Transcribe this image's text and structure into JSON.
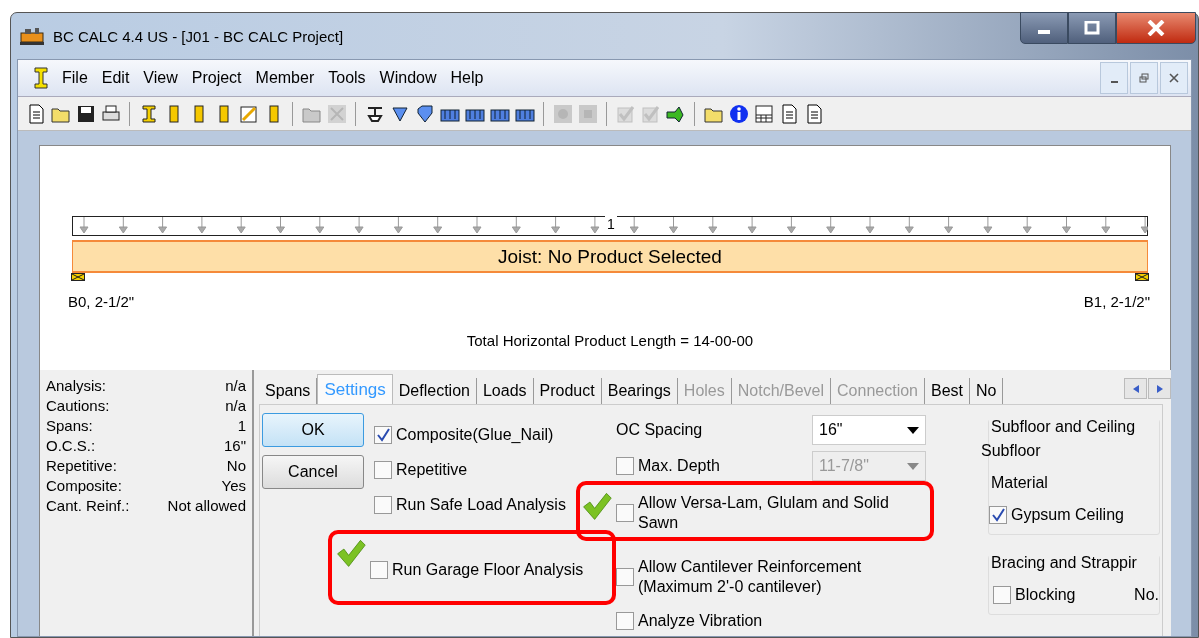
{
  "window": {
    "title": "BC CALC 4.4 US - [J01 - BC CALC Project]"
  },
  "menu": [
    "File",
    "Edit",
    "View",
    "Project",
    "Member",
    "Tools",
    "Window",
    "Help"
  ],
  "toolbar": [
    [
      {
        "kind": "document",
        "disabled": false
      },
      {
        "kind": "folder",
        "disabled": false
      },
      {
        "kind": "disk",
        "disabled": false
      },
      {
        "kind": "printer",
        "disabled": false
      }
    ],
    [
      {
        "kind": "beam",
        "disabled": false
      },
      {
        "kind": "column",
        "disabled": false
      },
      {
        "kind": "column",
        "disabled": false
      },
      {
        "kind": "column",
        "disabled": false
      },
      {
        "kind": "pencil",
        "disabled": false
      },
      {
        "kind": "column",
        "disabled": false
      }
    ],
    [
      {
        "kind": "folder",
        "disabled": true
      },
      {
        "kind": "cross",
        "disabled": true
      }
    ],
    [
      {
        "kind": "support",
        "disabled": false
      },
      {
        "kind": "triangle",
        "disabled": false
      },
      {
        "kind": "shield",
        "disabled": false
      },
      {
        "kind": "load",
        "disabled": false
      },
      {
        "kind": "load",
        "disabled": false
      },
      {
        "kind": "load",
        "disabled": false
      },
      {
        "kind": "load",
        "disabled": false
      }
    ],
    [
      {
        "kind": "circle",
        "disabled": true
      },
      {
        "kind": "square",
        "disabled": true
      }
    ],
    [
      {
        "kind": "check",
        "disabled": true
      },
      {
        "kind": "check",
        "disabled": true
      },
      {
        "kind": "arrow",
        "disabled": false
      }
    ],
    [
      {
        "kind": "folder",
        "disabled": false
      },
      {
        "kind": "info",
        "disabled": false
      },
      {
        "kind": "table",
        "disabled": false
      },
      {
        "kind": "document",
        "disabled": false
      },
      {
        "kind": "document",
        "disabled": false
      }
    ]
  ],
  "diagram": {
    "span_label": "1",
    "member_label": "Joist: No Product Selected",
    "left_bearing": "B0, 2-1/2\"",
    "right_bearing": "B1, 2-1/2\"",
    "total_length": "Total Horizontal Product Length = 14-00-00"
  },
  "summary": [
    {
      "label": "Analysis:",
      "value": "n/a"
    },
    {
      "label": "Cautions:",
      "value": "n/a"
    },
    {
      "label": "Spans:",
      "value": "1"
    },
    {
      "label": "O.C.S.:",
      "value": "16\""
    },
    {
      "label": "Repetitive:",
      "value": "No"
    },
    {
      "label": "Composite:",
      "value": "Yes"
    },
    {
      "label": "Cant. Reinf.:",
      "value": "Not allowed"
    }
  ],
  "tabs": [
    {
      "label": "Spans",
      "selected": false,
      "disabled": false
    },
    {
      "label": "Settings",
      "selected": true,
      "disabled": false
    },
    {
      "label": "Deflection",
      "selected": false,
      "disabled": false
    },
    {
      "label": "Loads",
      "selected": false,
      "disabled": false
    },
    {
      "label": "Product",
      "selected": false,
      "disabled": false
    },
    {
      "label": "Bearings",
      "selected": false,
      "disabled": false
    },
    {
      "label": "Holes",
      "selected": false,
      "disabled": true
    },
    {
      "label": "Notch/Bevel",
      "selected": false,
      "disabled": true
    },
    {
      "label": "Connection",
      "selected": false,
      "disabled": true
    },
    {
      "label": "Best",
      "selected": false,
      "disabled": false
    },
    {
      "label": "No",
      "selected": false,
      "disabled": false
    }
  ],
  "buttons": [
    "OK",
    "Cancel"
  ],
  "options_left": [
    {
      "label": "Composite(Glue_Nail)",
      "checked": true,
      "highlighted": false
    },
    {
      "label": "Repetitive",
      "checked": false,
      "highlighted": false
    },
    {
      "label": "Run Safe Load Analysis",
      "checked": false,
      "highlighted": false
    },
    {
      "label": "Run Garage Floor Analysis",
      "checked": false,
      "highlighted": true
    }
  ],
  "oc_spacing": {
    "label": "OC Spacing",
    "value": "16\""
  },
  "max_depth": {
    "label": "Max. Depth",
    "checked": false,
    "value": "11-7/8\""
  },
  "options_mid": [
    {
      "label": "Allow Versa-Lam, Glulam and Solid Sawn",
      "checked": false,
      "highlighted": true
    },
    {
      "label": "Allow Cantilever Reinforcement (Maximum 2'-0 cantilever)",
      "checked": false,
      "highlighted": false
    },
    {
      "label": "Analyze Vibration",
      "checked": false,
      "highlighted": false
    }
  ],
  "subfloor_group": {
    "title": "Subfloor and Ceiling",
    "subfloor": "Subfloor",
    "material": "Material",
    "gypsum": {
      "label": "Gypsum Ceiling",
      "checked": true
    }
  },
  "bracing_group": {
    "title": "Bracing and Strappir",
    "blocking": {
      "label": "Blocking",
      "checked": false
    },
    "column_label": "No."
  }
}
